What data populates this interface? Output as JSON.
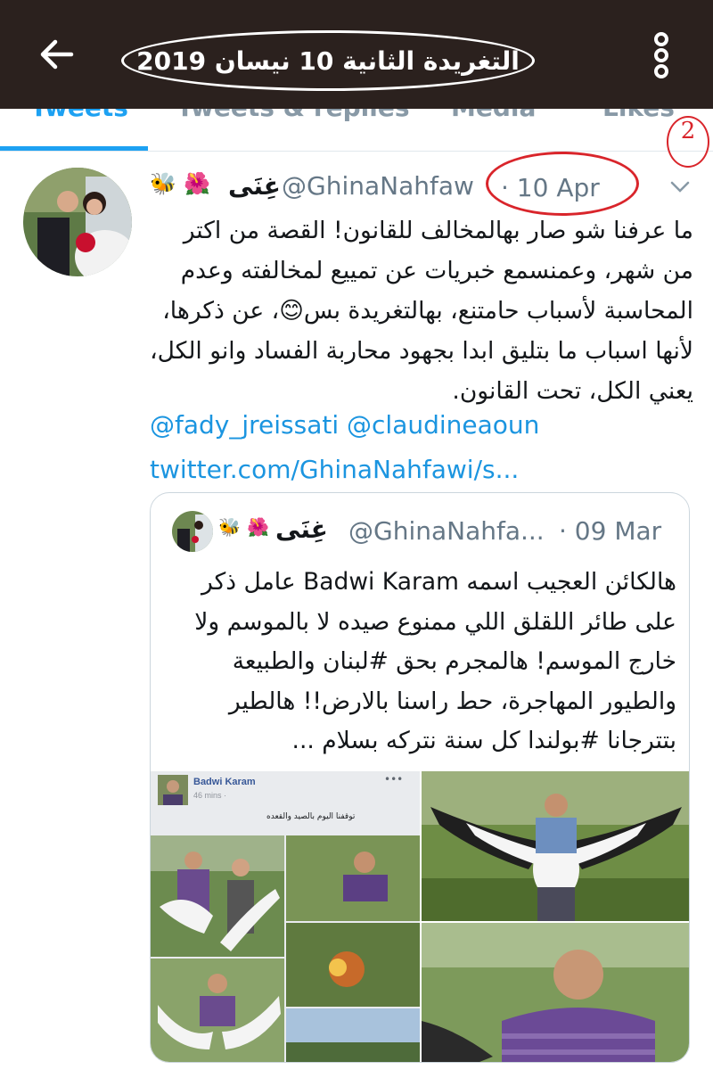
{
  "header": {
    "title": "التغريدة الثانية 10 نيسان 2019",
    "back_icon": "arrow-left-icon",
    "menu_icon": "more-vertical-icon"
  },
  "tabs": [
    {
      "label": "Tweets",
      "active": true
    },
    {
      "label": "Tweets & replies",
      "active": false
    },
    {
      "label": "Media",
      "active": false
    },
    {
      "label": "Likes",
      "active": false
    }
  ],
  "annotations": {
    "number": "2",
    "color": "#d9252b"
  },
  "tweet": {
    "display_name": "غِنَى",
    "name_emojis": "🐝🌺",
    "handle": "@GhinaNahfaw",
    "date": "· 10 Apr",
    "text": "ما عرفنا شو صار بهالمخالف للقانون! القصة من اكتر من شهر، وعمنسمع خبريات عن تمييع لمخالفته وعدم المحاسبة لأسباب حامتنع، بهالتغريدة بس😊، عن ذكرها، لأنها اسباب ما بتليق ابدا بجهود محاربة الفساد وانو الكل، يعني الكل، تحت القانون.",
    "mentions": "@fady_jreissati @claudineaoun",
    "link": "twitter.com/GhinaNahfawi/s..."
  },
  "quoted": {
    "display_name": "غِنَى",
    "name_emojis": "🐝🌺",
    "handle": "@GhinaNahfa...",
    "date": "· 09 Mar",
    "text": "هالكائن العجيب اسمه Badwi Karam عامل ذكر على طائر اللقلق اللي ممنوع صيده لا بالموسم ولا خارج الموسم! هالمجرم بحق #لبنان والطبيعة والطيور المهاجرة، حط راسنا بالارض!! هالطير بتترجانا #بولندا كل سنة نتركه بسلام ...",
    "fb_post": {
      "name": "Badwi Karam",
      "time": "46 mins · ",
      "caption": "توقفنا اليوم بالصيد والقعده"
    }
  },
  "colors": {
    "topbar": "#2b211e",
    "accent": "#1da1f2",
    "link": "#1b95e0",
    "annotation": "#d9252b",
    "muted": "#657786"
  }
}
